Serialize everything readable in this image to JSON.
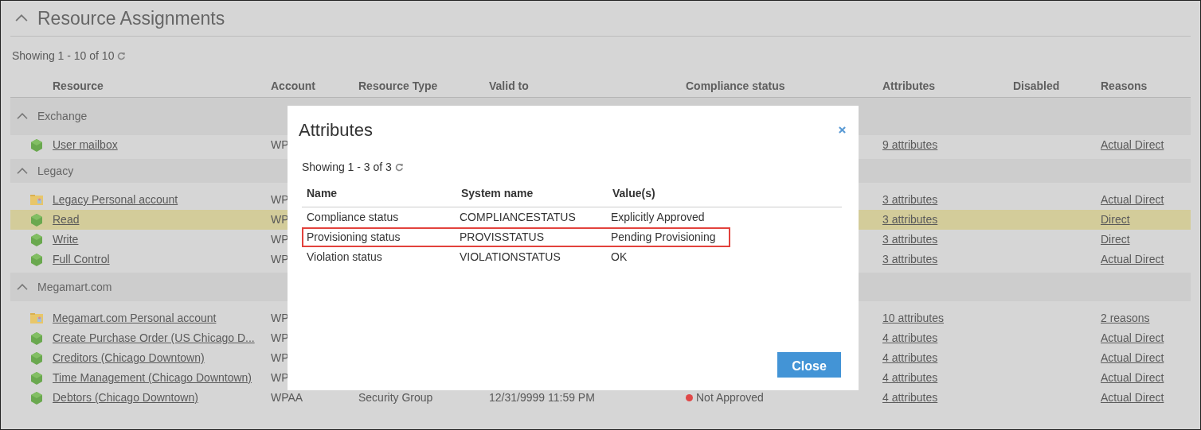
{
  "panel": {
    "title": "Resource Assignments",
    "expanded": true,
    "showing": "Showing 1 - 10 of 10"
  },
  "table": {
    "columns": [
      "Resource",
      "Account",
      "Resource Type",
      "Valid to",
      "Compliance status",
      "Attributes",
      "Disabled",
      "Reasons"
    ],
    "groups": [
      {
        "name": "Exchange",
        "expanded": true,
        "rows": [
          {
            "kind": "entitlement",
            "resource": "User mailbox",
            "account": "WP",
            "attributes": "9 attributes",
            "reasons": "Actual Direct",
            "selected": false
          }
        ]
      },
      {
        "name": "Legacy",
        "expanded": true,
        "rows": [
          {
            "kind": "account",
            "resource": "Legacy Personal account",
            "account": "WP",
            "attributes": "3 attributes",
            "reasons": "Actual Direct",
            "selected": false
          },
          {
            "kind": "entitlement",
            "resource": "Read",
            "account": "WP",
            "attributes": "3 attributes",
            "reasons": "Direct",
            "selected": true
          },
          {
            "kind": "entitlement",
            "resource": "Write",
            "account": "WP",
            "attributes": "3 attributes",
            "reasons": "Direct",
            "selected": false
          },
          {
            "kind": "entitlement",
            "resource": "Full Control",
            "account": "WP",
            "attributes": "3 attributes",
            "reasons": "Actual Direct",
            "selected": false
          }
        ]
      },
      {
        "name": "Megamart.com",
        "expanded": true,
        "rows": [
          {
            "kind": "account",
            "resource": "Megamart.com Personal account",
            "account": "WP",
            "attributes": "10 attributes",
            "reasons": "2 reasons",
            "selected": false
          },
          {
            "kind": "entitlement",
            "resource": "Create Purchase Order (US Chicago D...",
            "account": "WP",
            "attributes": "4 attributes",
            "reasons": "Actual Direct",
            "selected": false
          },
          {
            "kind": "entitlement",
            "resource": "Creditors (Chicago Downtown)",
            "account": "WP",
            "attributes": "4 attributes",
            "reasons": "Actual Direct",
            "selected": false
          },
          {
            "kind": "entitlement",
            "resource": "Time Management (Chicago Downtown)",
            "account": "WP",
            "attributes": "4 attributes",
            "reasons": "Actual Direct",
            "selected": false
          },
          {
            "kind": "entitlement",
            "resource": "Debtors (Chicago Downtown)",
            "account": "WPAA",
            "resource_type": "Security Group",
            "valid_to": "12/31/9999 11:59 PM",
            "compliance": {
              "text": "Not Approved",
              "color": "#e04848"
            },
            "attributes": "4 attributes",
            "reasons": "Actual Direct",
            "selected": false
          }
        ]
      }
    ]
  },
  "dialog": {
    "title": "Attributes",
    "showing": "Showing 1 - 3 of 3",
    "columns": [
      "Name",
      "System name",
      "Value(s)"
    ],
    "rows": [
      {
        "name": "Compliance status",
        "system_name": "COMPLIANCESTATUS",
        "value": "Explicitly Approved",
        "highlighted": false
      },
      {
        "name": "Provisioning status",
        "system_name": "PROVISSTATUS",
        "value": "Pending Provisioning",
        "highlighted": true
      },
      {
        "name": "Violation status",
        "system_name": "VIOLATIONSTATUS",
        "value": "OK",
        "highlighted": false
      }
    ],
    "button": "Close"
  }
}
